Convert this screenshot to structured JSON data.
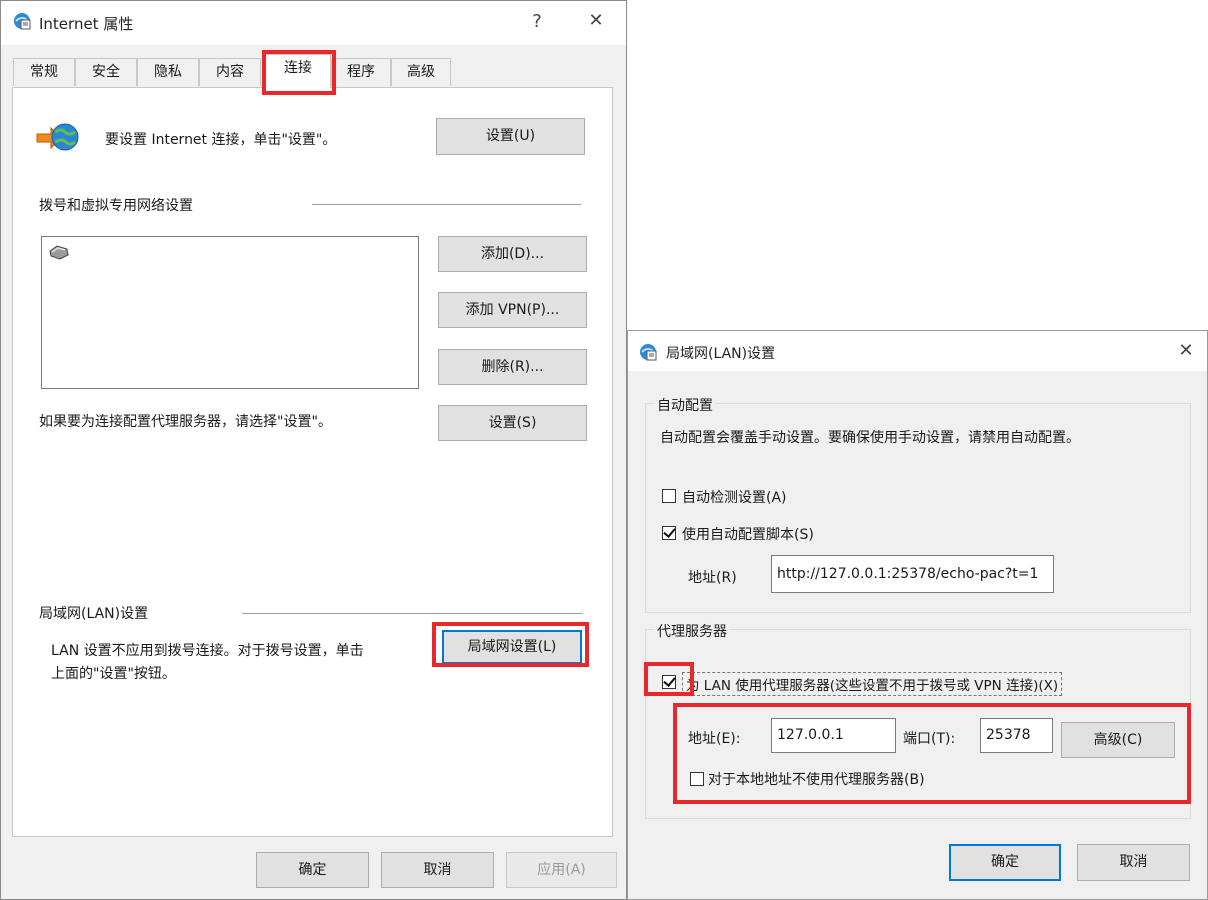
{
  "inet": {
    "title": "Internet 属性",
    "help": "?",
    "close": "✕",
    "tabs": [
      "常规",
      "安全",
      "隐私",
      "内容",
      "连接",
      "程序",
      "高级"
    ],
    "setup_text": "要设置 Internet 连接，单击\"设置\"。",
    "setup_button": "设置(U)",
    "dialup_heading": "拨号和虚拟专用网络设置",
    "add_button": "添加(D)...",
    "add_vpn_button": "添加 VPN(P)...",
    "remove_button": "删除(R)...",
    "proxy_text": "如果要为连接配置代理服务器，请选择\"设置\"。",
    "settings_button": "设置(S)",
    "lan_heading": "局域网(LAN)设置",
    "lan_text_line1": "LAN 设置不应用到拨号连接。对于拨号设置，单击",
    "lan_text_line2": "上面的\"设置\"按钮。",
    "lan_button": "局域网设置(L)",
    "ok": "确定",
    "cancel": "取消",
    "apply": "应用(A)"
  },
  "lan": {
    "title": "局域网(LAN)设置",
    "close": "✕",
    "auto_group": "自动配置",
    "auto_desc": "自动配置会覆盖手动设置。要确保使用手动设置，请禁用自动配置。",
    "auto_detect": "自动检测设置(A)",
    "auto_detect_checked": false,
    "use_script": "使用自动配置脚本(S)",
    "use_script_checked": true,
    "address_label": "地址(R)",
    "script_url": "http://127.0.0.1:25378/echo-pac?t=1",
    "proxy_group": "代理服务器",
    "use_proxy": "为 LAN 使用代理服务器(这些设置不用于拨号或 VPN 连接)(X)",
    "use_proxy_checked": true,
    "proxy_address_label": "地址(E):",
    "proxy_address": "127.0.0.1",
    "port_label": "端口(T):",
    "port": "25378",
    "advanced_button": "高级(C)",
    "bypass_local": "对于本地地址不使用代理服务器(B)",
    "bypass_local_checked": false,
    "ok": "确定",
    "cancel": "取消"
  },
  "colors": {
    "highlight": "#e8282b",
    "focus": "#0078d7"
  }
}
